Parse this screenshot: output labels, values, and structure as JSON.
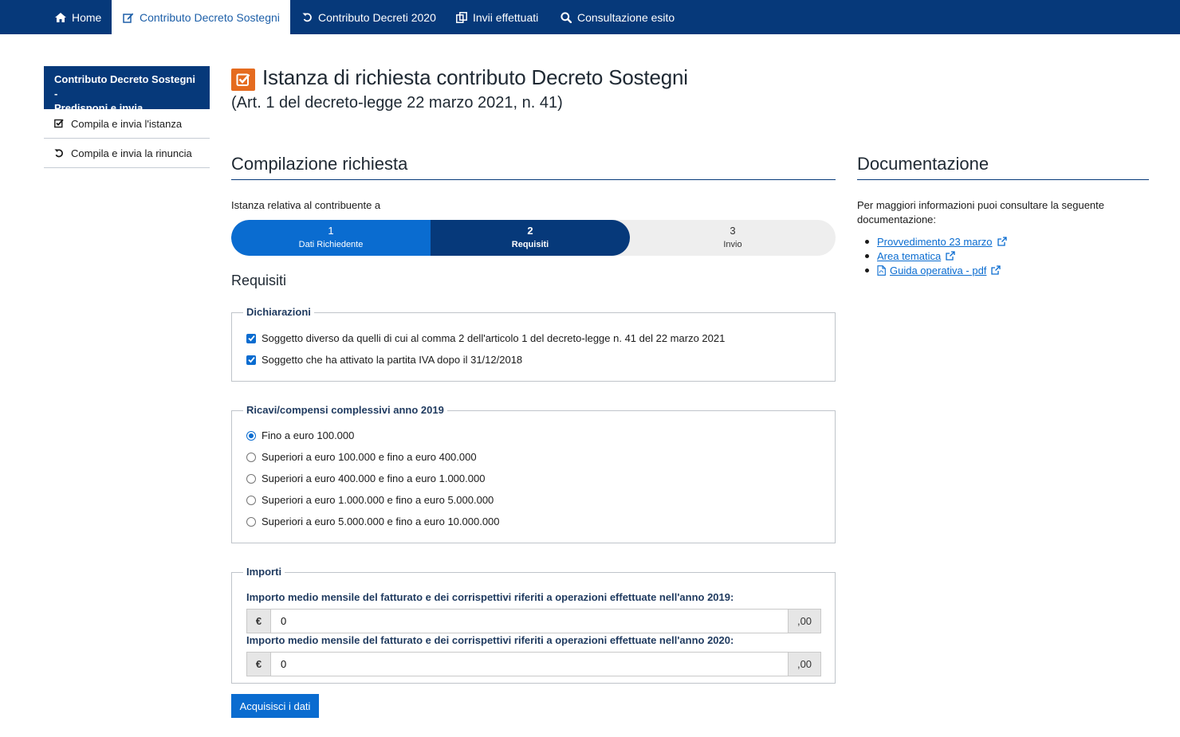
{
  "nav": {
    "items": [
      {
        "label": "Home",
        "icon": "home-icon",
        "active": false
      },
      {
        "label": "Contributo Decreto Sostegni",
        "icon": "edit-icon",
        "active": true
      },
      {
        "label": "Contributo Decreti 2020",
        "icon": "undo-icon",
        "active": false
      },
      {
        "label": "Invii effettuati",
        "icon": "copy-icon",
        "active": false
      },
      {
        "label": "Consultazione esito",
        "icon": "search-icon",
        "active": false
      }
    ]
  },
  "sidebar": {
    "header_line1": "Contributo Decreto Sostegni -",
    "header_line2": "Predisponi e invia",
    "items": [
      {
        "label": "Compila e invia l'istanza",
        "icon": "check-square-icon"
      },
      {
        "label": "Compila e invia la rinuncia",
        "icon": "undo-icon"
      }
    ]
  },
  "page": {
    "title": "Istanza di richiesta contributo Decreto Sostegni",
    "subtitle": "(Art. 1 del decreto-legge 22 marzo 2021, n. 41)"
  },
  "form": {
    "heading": "Compilazione richiesta",
    "contributor_label": "Istanza relativa al contribuente a",
    "steps": [
      {
        "number": "1",
        "label": "Dati Richiedente"
      },
      {
        "number": "2",
        "label": "Requisiti"
      },
      {
        "number": "3",
        "label": "Invio"
      }
    ],
    "current_step": 2,
    "requisiti_heading": "Requisiti",
    "dichiarazioni": {
      "legend": "Dichiarazioni",
      "items": [
        {
          "label": "Soggetto diverso da quelli di cui al comma 2 dell'articolo 1 del decreto-legge n. 41 del 22 marzo 2021",
          "checked": true
        },
        {
          "label": "Soggetto che ha attivato la partita IVA dopo il 31/12/2018",
          "checked": true
        }
      ]
    },
    "ricavi": {
      "legend": "Ricavi/compensi complessivi anno 2019",
      "options": [
        {
          "label": "Fino a euro 100.000",
          "selected": true
        },
        {
          "label": "Superiori a euro 100.000 e fino a euro 400.000",
          "selected": false
        },
        {
          "label": "Superiori a euro 400.000 e fino a euro 1.000.000",
          "selected": false
        },
        {
          "label": "Superiori a euro 1.000.000 e fino a euro 5.000.000",
          "selected": false
        },
        {
          "label": "Superiori a euro 5.000.000 e fino a euro 10.000.000",
          "selected": false
        }
      ]
    },
    "importi": {
      "legend": "Importi",
      "fields": [
        {
          "label": "Importo medio mensile del fatturato e dei corrispettivi riferiti a operazioni effettuate nell'anno 2019:",
          "prefix": "€",
          "value": "0",
          "suffix": ",00"
        },
        {
          "label": "Importo medio mensile del fatturato e dei corrispettivi riferiti a operazioni effettuate nell'anno 2020:",
          "prefix": "€",
          "value": "0",
          "suffix": ",00"
        }
      ]
    },
    "submit_label": "Acquisisci i dati"
  },
  "documentazione": {
    "heading": "Documentazione",
    "intro": "Per maggiori informazioni puoi consultare la seguente documentazione:",
    "links": [
      {
        "label": "Provvedimento 23 marzo",
        "pdf": false
      },
      {
        "label": "Area tematica",
        "pdf": false
      },
      {
        "label": "Guida operativa - pdf",
        "pdf": true
      }
    ]
  },
  "colors": {
    "nav_bg": "#06397a",
    "accent": "#0a6cd0",
    "title_icon": "#e56b1f"
  }
}
